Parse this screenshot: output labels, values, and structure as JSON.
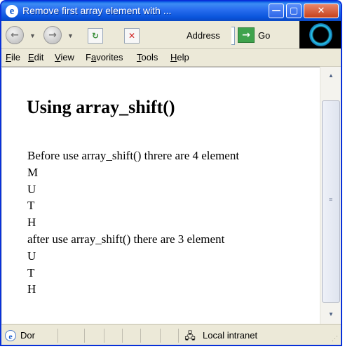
{
  "window": {
    "title": "Remove first array element with ...",
    "buttons": {
      "minimize": "—",
      "maximize": "▢",
      "close": "✕"
    }
  },
  "toolbar": {
    "back_icon": "back-arrow-icon",
    "forward_icon": "forward-arrow-icon",
    "refresh_icon": "refresh-icon",
    "stop_icon": "stop-icon",
    "address_label": "Address",
    "go_label": "Go"
  },
  "menu": {
    "items": [
      {
        "label": "File",
        "key": "F"
      },
      {
        "label": "Edit",
        "key": "E"
      },
      {
        "label": "View",
        "key": "V"
      },
      {
        "label": "Favorites",
        "key": "a"
      },
      {
        "label": "Tools",
        "key": "T"
      },
      {
        "label": "Help",
        "key": "H"
      }
    ]
  },
  "page": {
    "heading": "Using array_shift()",
    "lines": [
      "Before use array_shift() threre are 4 element",
      "M",
      "U",
      "T",
      "H",
      "after use array_shift() there are 3 element",
      "U",
      "T",
      "H"
    ]
  },
  "status": {
    "text": "Dor",
    "zone": "Local intranet"
  },
  "colors": {
    "titlebar": "#0a55dc",
    "chrome": "#ece9d8",
    "go_button": "#3fa34d"
  }
}
